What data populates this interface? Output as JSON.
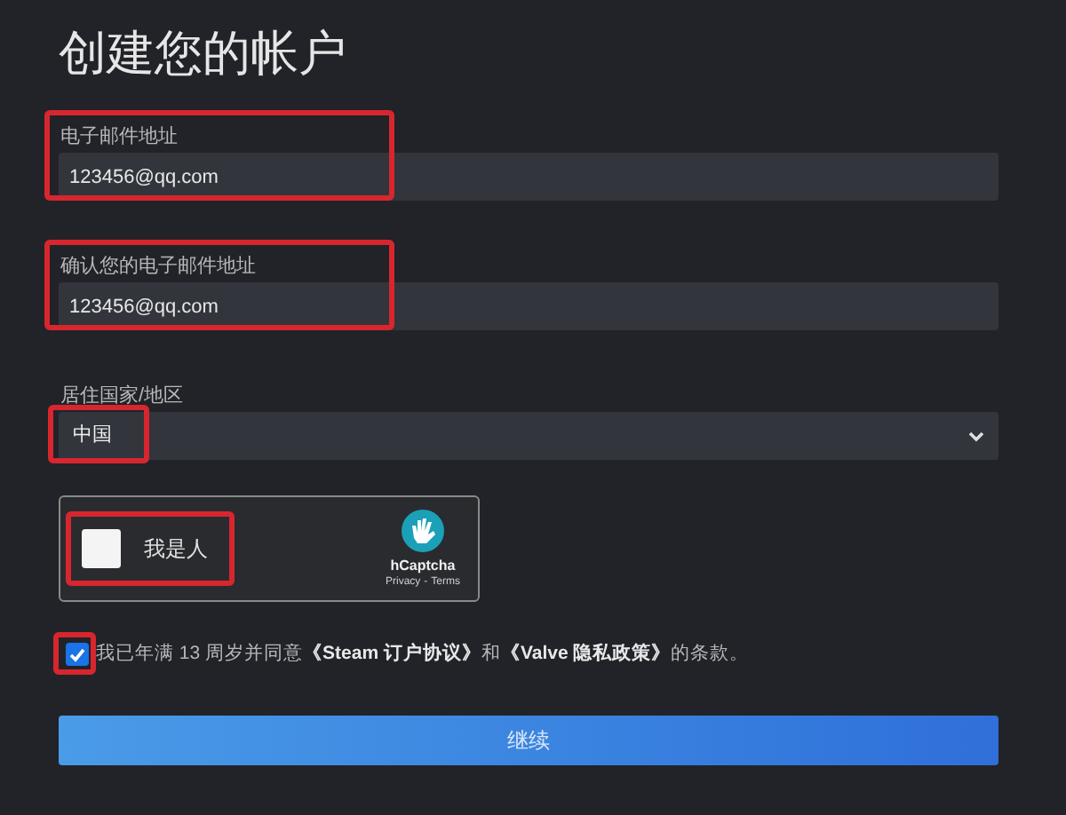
{
  "title": "创建您的帐户",
  "fields": [
    {
      "kind": "input",
      "label": "电子邮件地址",
      "value": "123456@qq.com",
      "highlighted": true
    },
    {
      "kind": "input",
      "label": "确认您的电子邮件地址",
      "value": "123456@qq.com",
      "highlighted": true
    },
    {
      "kind": "select",
      "label": "居住国家/地区",
      "value": "中国",
      "highlighted": true
    }
  ],
  "captcha": {
    "label": "我是人",
    "checked": false,
    "highlighted": true,
    "brand": "hCaptcha",
    "links": [
      "Privacy",
      "Terms"
    ],
    "separator": "-"
  },
  "agreement": {
    "checked": true,
    "highlighted": true,
    "text": "我已年满 13 周岁并同意**《Steam 订户协议》**和**《Valve 隐私政策》**的条款。"
  },
  "submit": {
    "label": "继续"
  }
}
